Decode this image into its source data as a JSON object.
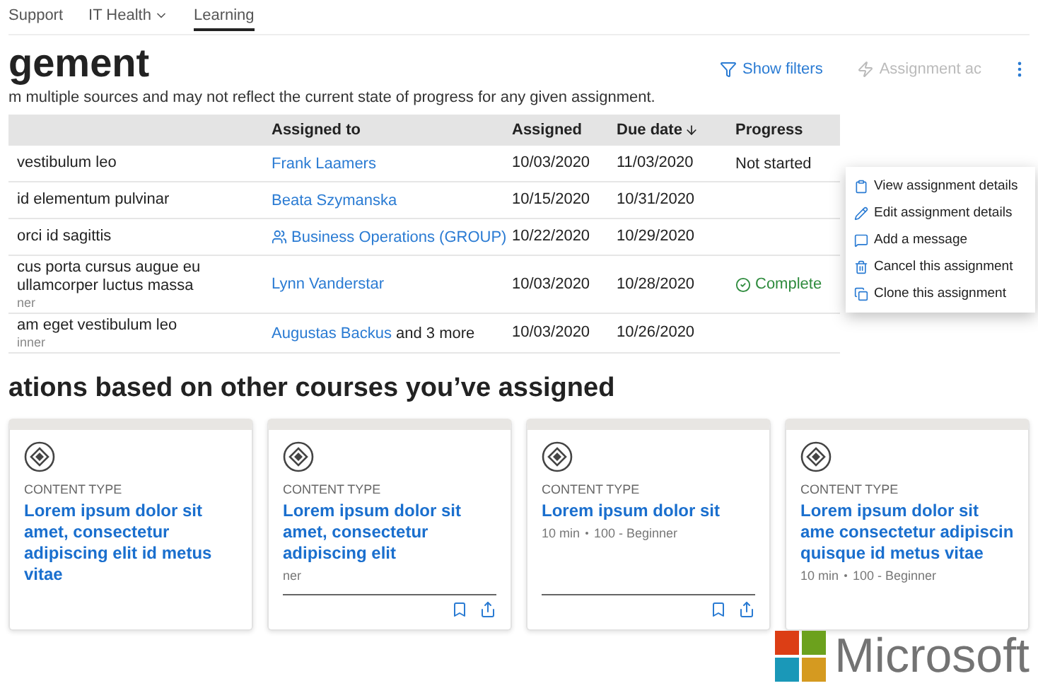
{
  "nav": [
    {
      "label": "Support",
      "selected": false,
      "dropdown": false
    },
    {
      "label": "IT Health",
      "selected": false,
      "dropdown": true
    },
    {
      "label": "Learning",
      "selected": true,
      "dropdown": false
    }
  ],
  "title": "gement",
  "description": "m multiple sources and may not reflect the current state of progress for any given assignment.",
  "toolbar": [
    {
      "label": "Show filters",
      "disabled": false
    },
    {
      "label": "Assignment ac",
      "disabled": true
    }
  ],
  "table": {
    "columns": [
      {
        "label": "Assigned to",
        "sorted": false
      },
      {
        "label": "Assigned",
        "sorted": false
      },
      {
        "label": "Due date",
        "sorted": true
      },
      {
        "label": "Progress",
        "sorted": false
      }
    ],
    "rows": [
      {
        "title": "vestibulum leo",
        "assignee": {
          "kind": "person",
          "name": "Frank Laamers"
        },
        "assigned": "10/03/2020",
        "due": "11/03/2020",
        "progress": {
          "kind": "not_started",
          "label": "Not started"
        }
      },
      {
        "title": "id elementum pulvinar",
        "assignee": {
          "kind": "person",
          "name": "Beata Szymanska"
        },
        "assigned": "10/15/2020",
        "due": "10/31/2020"
      },
      {
        "title": "orci id sagittis",
        "assignee": {
          "kind": "group",
          "name": "Business Operations (GROUP)"
        },
        "assigned": "10/22/2020",
        "due": "10/29/2020"
      },
      {
        "title": "cus porta cursus augue eu ullamcorper luctus massa",
        "meta": "ner",
        "assignee": {
          "kind": "person",
          "name": "Lynn Vanderstar"
        },
        "assigned": "10/03/2020",
        "due": "10/28/2020",
        "progress": {
          "kind": "complete",
          "label": "Complete"
        }
      },
      {
        "title": "am eget vestibulum leo",
        "meta": "inner",
        "assignee": {
          "kind": "person",
          "name": "Augustas Backus",
          "extra": "and 3 more"
        },
        "assigned": "10/03/2020",
        "due": "10/26/2020"
      }
    ]
  },
  "context_menu": [
    {
      "label": "View assignment details"
    },
    {
      "label": "Edit assignment details"
    },
    {
      "label": "Add a message"
    },
    {
      "label": "Cancel this assignment"
    },
    {
      "label": "Clone this assignment"
    }
  ],
  "recommendations": {
    "heading": "ations based on other courses you’ve assigned",
    "cards": [
      {
        "content_type": "CONTENT TYPE",
        "title": "Lorem ipsum dolor sit amet, consectetur adipiscing elit id metus vitae",
        "actions": false
      },
      {
        "content_type": "CONTENT TYPE",
        "title": "Lorem ipsum dolor sit amet, consectetur adipiscing elit",
        "meta": [
          "ner"
        ],
        "actions": true
      },
      {
        "content_type": "CONTENT TYPE",
        "title": "Lorem ipsum dolor sit",
        "meta": [
          "10 min",
          "100 - Beginner"
        ],
        "actions": true
      },
      {
        "content_type": "CONTENT TYPE",
        "title": "Lorem ipsum dolor sit ame consectetur adipiscin quisque id metus vitae",
        "meta": [
          "10 min",
          "100 - Beginner"
        ],
        "actions": false
      }
    ]
  },
  "logo": {
    "text": "Microsoft"
  }
}
